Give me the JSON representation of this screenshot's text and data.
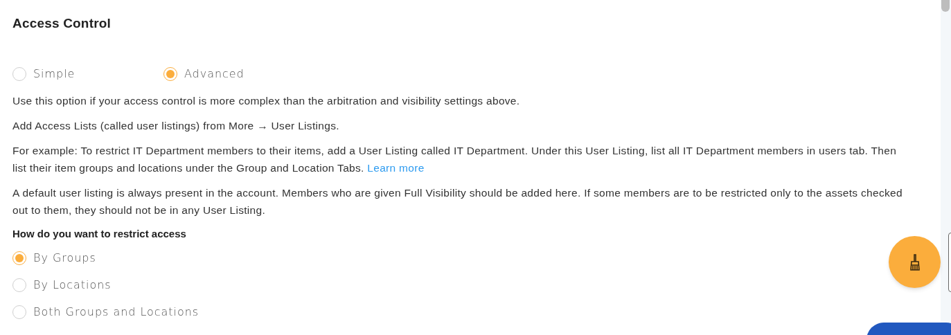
{
  "title": "Access Control",
  "mode_options": [
    {
      "label": "Simple",
      "selected": false
    },
    {
      "label": "Advanced",
      "selected": true
    }
  ],
  "paragraphs": [
    {
      "text": "Use this option if your access control is more complex than the arbitration and visibility settings above."
    },
    {
      "text": "Add Access Lists (called user listings) from More → User Listings."
    },
    {
      "text": "For example: To restrict IT Department members to their items, add a User Listing called IT Department. Under this User Listing, list all IT Department members in users tab. Then list their item groups and locations under the Group and Location Tabs.",
      "link": "Learn more"
    },
    {
      "text": "A default user listing is always present in the account. Members who are given Full Visibility should be added here. If some members are to be restricted only to the assets checked out to them, they should not be in any User Listing."
    }
  ],
  "restrict": {
    "heading": "How do you want to restrict access",
    "options": [
      {
        "label": "By Groups",
        "selected": true
      },
      {
        "label": "By Locations",
        "selected": false
      },
      {
        "label": "Both Groups and Locations",
        "selected": false
      }
    ]
  }
}
